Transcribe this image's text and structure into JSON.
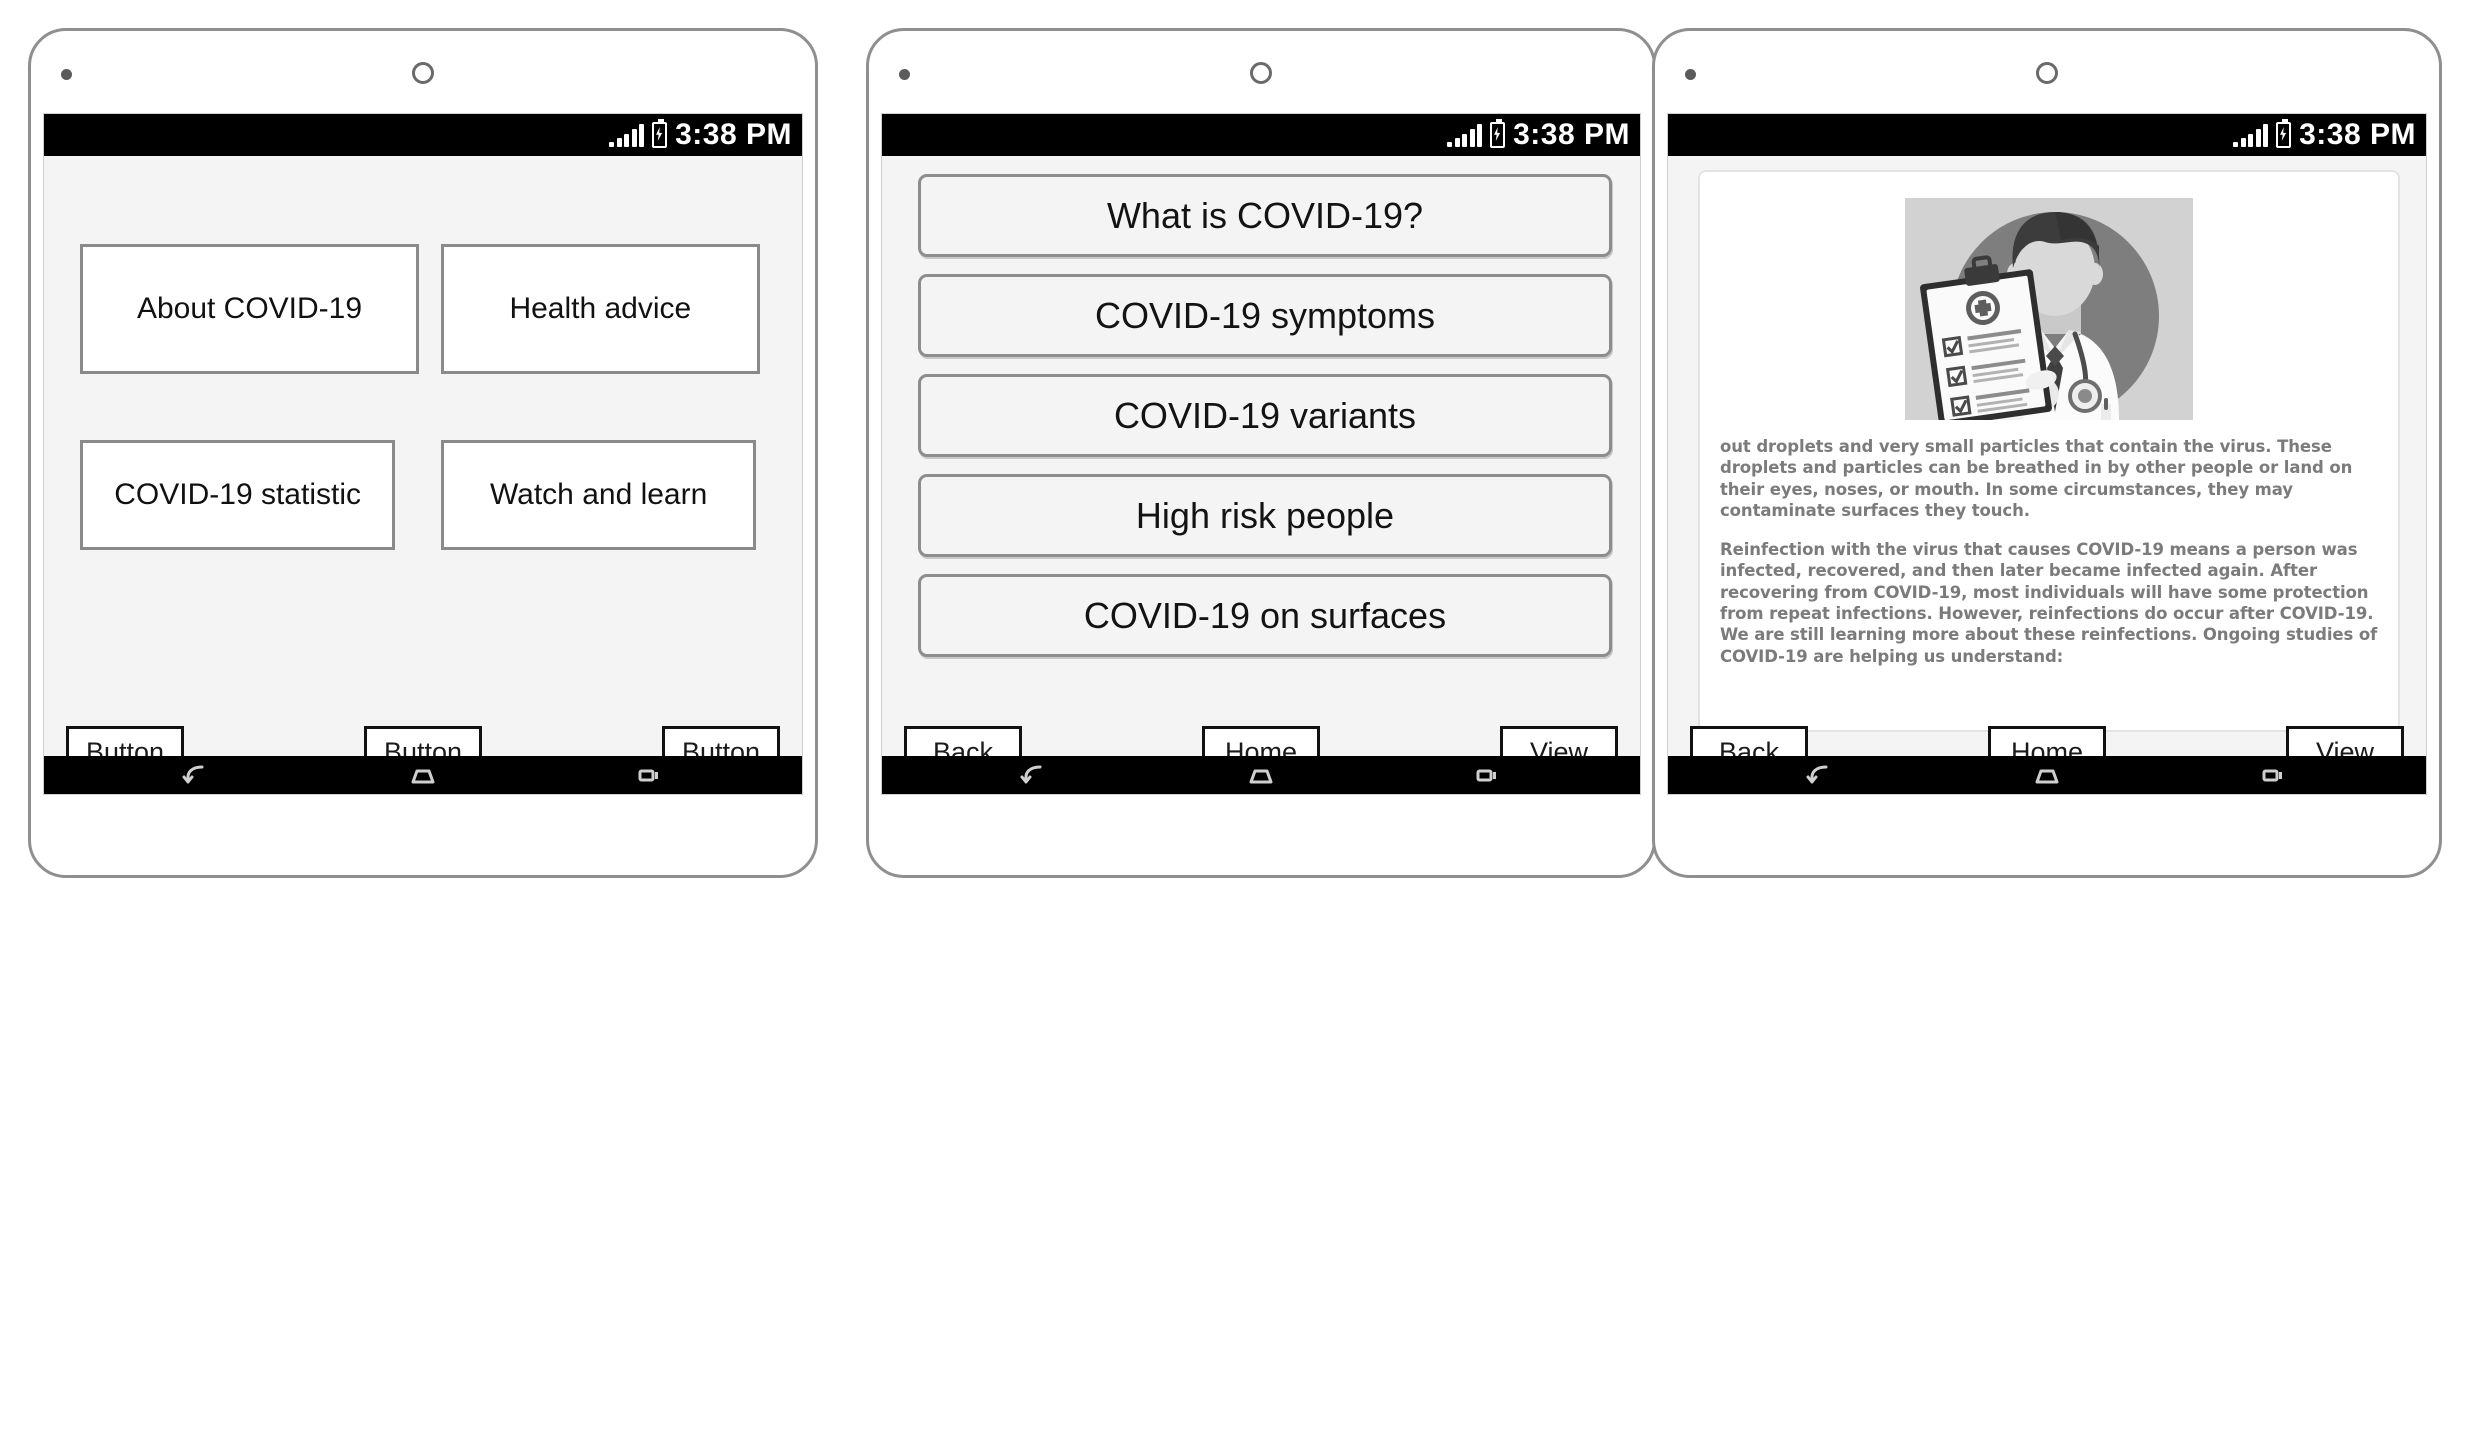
{
  "status_bar": {
    "time": "3:38 PM",
    "signal_icon": "signal-bars-icon",
    "battery_icon": "battery-charging-icon"
  },
  "nav_bar": {
    "back_icon": "android-back-icon",
    "home_icon": "android-home-icon",
    "recents_icon": "android-recents-icon"
  },
  "screens": [
    {
      "name": "home-menu",
      "tiles": [
        {
          "label": "About COVID-19"
        },
        {
          "label": "Health advice"
        },
        {
          "label": "COVID-19 statistic"
        },
        {
          "label": "Watch and learn"
        }
      ],
      "footer_buttons": [
        {
          "label": "Button"
        },
        {
          "label": "Button"
        },
        {
          "label": "Button"
        }
      ]
    },
    {
      "name": "about-covid-list",
      "items": [
        {
          "label": "What is COVID-19?"
        },
        {
          "label": "COVID-19 symptoms"
        },
        {
          "label": "COVID-19 variants"
        },
        {
          "label": "High risk people"
        },
        {
          "label": "COVID-19 on surfaces"
        }
      ],
      "footer_buttons": [
        {
          "label": "Back"
        },
        {
          "label": "Home"
        },
        {
          "label": "View"
        }
      ]
    },
    {
      "name": "article-detail",
      "hero_image": "doctor-with-clipboard-illustration",
      "paragraphs": [
        "out droplets and very small particles that contain the virus. These droplets and particles can be breathed in by other people or land on their eyes, noses, or mouth. In some circumstances, they may contaminate surfaces they touch.",
        "Reinfection with the virus that causes COVID-19 means a person was infected, recovered, and then later became infected again. After recovering from COVID-19, most individuals will have some protection from repeat infections. However, reinfections do occur after COVID-19. We are still learning more about these reinfections. Ongoing studies of COVID-19 are helping us understand:"
      ],
      "footer_buttons": [
        {
          "label": "Back"
        },
        {
          "label": "Home"
        },
        {
          "label": "View"
        }
      ]
    }
  ],
  "colors": {
    "screen_bg": "#f4f4f4",
    "status_bar_bg": "#000000",
    "tile_border": "#8a8a8a",
    "list_border": "#8d8d8d",
    "bezel": "#8f8f8f",
    "article_text": "#7b7b7b"
  }
}
